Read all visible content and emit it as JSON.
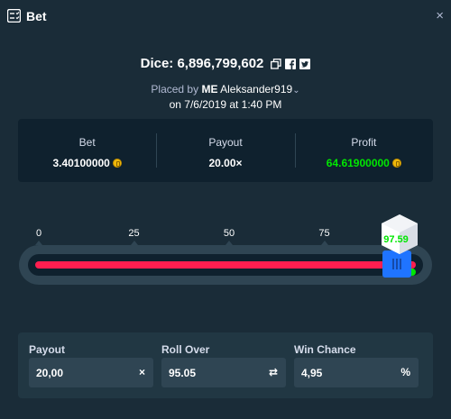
{
  "header": {
    "title": "Bet",
    "icon": "bet-slip-icon",
    "close_label": "×"
  },
  "bet": {
    "game_label": "Dice: 6,896,799,602",
    "placed_by_prefix": "Placed by",
    "user_badge": "ME",
    "username": "Aleksander919",
    "date_line": "on 7/6/2019 at 1:40 PM"
  },
  "stats": {
    "bet_label": "Bet",
    "bet_value": "3.40100000",
    "payout_label": "Payout",
    "payout_value": "20.00×",
    "profit_label": "Profit",
    "profit_value": "64.61900000"
  },
  "slider": {
    "ticks": [
      "0",
      "25",
      "50",
      "75"
    ],
    "roll_over": 95.05,
    "result": "97.59",
    "range": [
      0,
      100
    ]
  },
  "fields": {
    "payout_label": "Payout",
    "payout_value": "20,00",
    "payout_suffix": "×",
    "roll_over_label": "Roll Over",
    "roll_over_value": "95.05",
    "roll_over_suffix": "⇄",
    "win_chance_label": "Win Chance",
    "win_chance_value": "4,95",
    "win_chance_suffix": "%"
  },
  "colors": {
    "background": "#1a2c38",
    "panel": "#0f212e",
    "lose": "#ff1e50",
    "win": "#00e701",
    "handle": "#1f74ff"
  }
}
